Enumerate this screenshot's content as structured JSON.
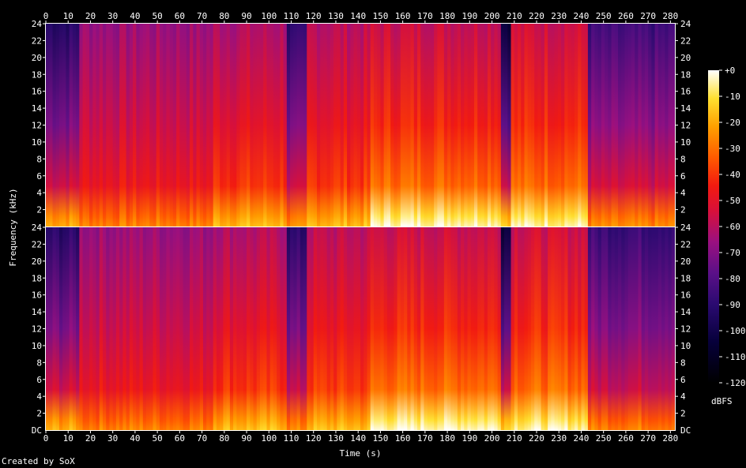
{
  "footer": "Created by SoX",
  "chart_data": {
    "type": "heatmap",
    "title": "",
    "xlabel": "Time (s)",
    "ylabel": "Frequency (kHz)",
    "xlim": [
      0,
      282
    ],
    "ylim": [
      0,
      24
    ],
    "x_ticks": [
      0,
      10,
      20,
      30,
      40,
      50,
      60,
      70,
      80,
      90,
      100,
      110,
      120,
      130,
      140,
      150,
      160,
      170,
      180,
      190,
      200,
      210,
      220,
      230,
      240,
      250,
      260,
      270,
      280
    ],
    "y_ticks": [
      2,
      4,
      6,
      8,
      10,
      12,
      14,
      16,
      18,
      20,
      22,
      24
    ],
    "y_tick_labels": [
      "2",
      "4",
      "6",
      "8",
      "10",
      "12",
      "14",
      "16",
      "18",
      "20",
      "22",
      "24"
    ],
    "dc_label": "DC",
    "channels": 2,
    "colorbar": {
      "label": "dBFS",
      "range": [
        -120,
        0
      ],
      "ticks": [
        "+0",
        "-10",
        "-20",
        "-30",
        "-40",
        "-50",
        "-60",
        "-70",
        "-80",
        "-90",
        "-100",
        "-110",
        "-120"
      ]
    },
    "segments": [
      {
        "t0": 0,
        "t1": 15,
        "low_db": -25,
        "high_db": -92
      },
      {
        "t0": 15,
        "t1": 75,
        "low_db": -32,
        "high_db": -66
      },
      {
        "t0": 75,
        "t1": 107,
        "low_db": -22,
        "high_db": -62
      },
      {
        "t0": 107,
        "t1": 117,
        "low_db": -32,
        "high_db": -92
      },
      {
        "t0": 117,
        "t1": 145,
        "low_db": -22,
        "high_db": -60
      },
      {
        "t0": 145,
        "t1": 203,
        "low_db": -8,
        "high_db": -57
      },
      {
        "t0": 203,
        "t1": 208,
        "low_db": -18,
        "high_db": -102
      },
      {
        "t0": 208,
        "t1": 243,
        "low_db": -10,
        "high_db": -56
      },
      {
        "t0": 243,
        "t1": 282,
        "low_db": -32,
        "high_db": -86
      }
    ]
  }
}
